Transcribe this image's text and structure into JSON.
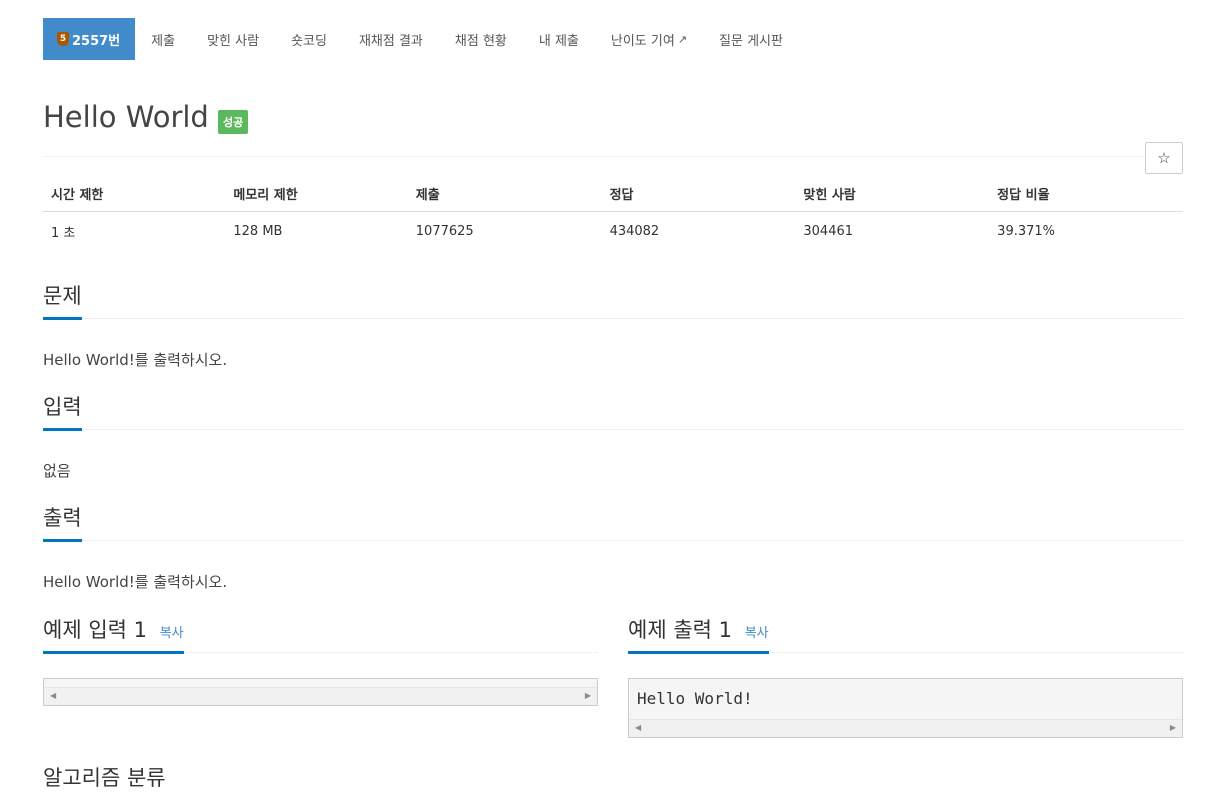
{
  "nav": {
    "problem_badge": "5",
    "problem_number": "2557번",
    "items": [
      "제출",
      "맞힌 사람",
      "숏코딩",
      "재채점 결과",
      "채점 현황",
      "내 제출",
      "난이도 기여",
      "질문 게시판"
    ]
  },
  "problem": {
    "title": "Hello World",
    "status": "성공",
    "star": "☆"
  },
  "info": {
    "headers": [
      "시간 제한",
      "메모리 제한",
      "제출",
      "정답",
      "맞힌 사람",
      "정답 비율"
    ],
    "values": [
      "1 초",
      "128 MB",
      "1077625",
      "434082",
      "304461",
      "39.371%"
    ]
  },
  "sections": {
    "description_title": "문제",
    "description": "Hello World!를 출력하시오.",
    "input_title": "입력",
    "input": "없음",
    "output_title": "출력",
    "output": "Hello World!를 출력하시오."
  },
  "samples": {
    "input_title": "예제 입력 1",
    "output_title": "예제 출력 1",
    "copy_label": "복사",
    "input_value": "",
    "output_value": "Hello World!"
  },
  "next_section_title": "알고리즘 분류",
  "colors": {
    "accent": "#428bca",
    "success": "#5cb85c",
    "underline": "#0076c0"
  }
}
